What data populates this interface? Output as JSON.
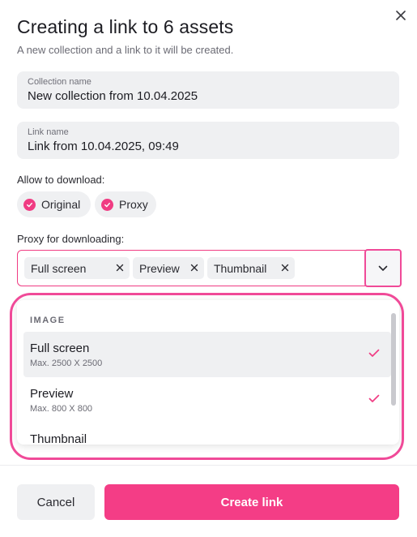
{
  "dialog": {
    "title": "Creating a link to 6 assets",
    "subtitle": "A new collection and a link to it will be created."
  },
  "collection_field": {
    "label": "Collection name",
    "value": "New collection from 10.04.2025"
  },
  "link_field": {
    "label": "Link name",
    "value": "Link from 10.04.2025, 09:49"
  },
  "download": {
    "label": "Allow to download:",
    "options": [
      {
        "label": "Original",
        "checked": true
      },
      {
        "label": "Proxy",
        "checked": true
      }
    ]
  },
  "proxy": {
    "label": "Proxy for downloading:",
    "selected_tags": [
      "Full screen",
      "Preview",
      "Thumbnail"
    ]
  },
  "dropdown": {
    "group": "IMAGE",
    "items": [
      {
        "name": "Full screen",
        "sub": "Max. 2500 X 2500",
        "selected": true
      },
      {
        "name": "Preview",
        "sub": "Max. 800 X 800",
        "selected": true
      },
      {
        "name": "Thumbnail",
        "sub": "",
        "selected": true
      }
    ]
  },
  "footer": {
    "cancel_label": "Cancel",
    "create_label": "Create link"
  },
  "colors": {
    "accent": "#f43d86",
    "field_bg": "#eff0f2",
    "highlight": "#f04a98"
  },
  "icons": {
    "close": "close-icon",
    "check": "check-icon",
    "chevron": "chevron-down-icon",
    "remove": "x-icon"
  }
}
